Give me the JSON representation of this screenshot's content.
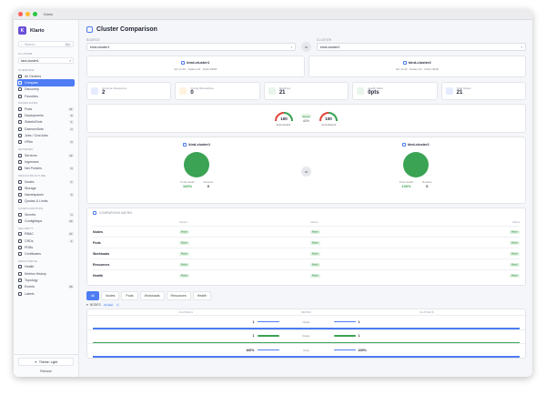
{
  "window": {
    "title": "Klario"
  },
  "brand": {
    "name": "Klario"
  },
  "search": {
    "placeholder": "Search...",
    "shortcut": "⌘K"
  },
  "sidebar": {
    "cluster_section": "CLUSTER",
    "cluster_value": "kind-cluster1",
    "sections": [
      {
        "label": "OVERVIEW",
        "items": [
          {
            "label": "All Clusters",
            "badge": ""
          },
          {
            "label": "Compare",
            "badge": "",
            "active": true
          },
          {
            "label": "Discovery",
            "badge": ""
          },
          {
            "label": "Favorites",
            "badge": ""
          }
        ]
      },
      {
        "label": "WORKLOADS",
        "items": [
          {
            "label": "Pods",
            "badge": "21"
          },
          {
            "label": "Deployments",
            "badge": "8"
          },
          {
            "label": "StatefulSets",
            "badge": "1"
          },
          {
            "label": "DaemonSets",
            "badge": "3"
          },
          {
            "label": "Jobs / CronJobs",
            "badge": ""
          },
          {
            "label": "HPAs",
            "badge": "0"
          }
        ]
      },
      {
        "label": "NETWORK",
        "items": [
          {
            "label": "Services",
            "badge": "12"
          },
          {
            "label": "Ingresses",
            "badge": ""
          },
          {
            "label": "Net Policies",
            "badge": "0"
          }
        ]
      },
      {
        "label": "INFRASTRUCTURE",
        "items": [
          {
            "label": "Nodes",
            "badge": "1"
          },
          {
            "label": "Storage",
            "badge": ""
          },
          {
            "label": "Namespaces",
            "badge": "6"
          },
          {
            "label": "Quotas & Limits",
            "badge": ""
          }
        ]
      },
      {
        "label": "CONFIGURATION",
        "items": [
          {
            "label": "Secrets",
            "badge": "4"
          },
          {
            "label": "ConfigMaps",
            "badge": "14"
          }
        ]
      },
      {
        "label": "SECURITY",
        "items": [
          {
            "label": "RBAC",
            "badge": "47"
          },
          {
            "label": "CRDs",
            "badge": "1"
          },
          {
            "label": "PDBs",
            "badge": ""
          },
          {
            "label": "Certificates",
            "badge": ""
          }
        ]
      },
      {
        "label": "MONITORING",
        "items": [
          {
            "label": "Health",
            "badge": ""
          },
          {
            "label": "Metrics History",
            "badge": ""
          },
          {
            "label": "Topology",
            "badge": ""
          },
          {
            "label": "Events",
            "badge": "45"
          },
          {
            "label": "Labels",
            "badge": ""
          }
        ]
      }
    ],
    "theme_label": "Theme: Light",
    "release_label": "Release"
  },
  "page": {
    "title": "Cluster Comparison",
    "source_label": "SOURCE",
    "target_label": "CLUSTER",
    "source_value": "kind-cluster1",
    "target_value": "kind-cluster2",
    "vs": "vs"
  },
  "clusters": [
    {
      "name": "kind-cluster1",
      "meta": "Ver v1.33 · Nodes 1/1 · Pods 18/18"
    },
    {
      "name": "kind-cluster2",
      "meta": "Ver v1.32 · Nodes 1/1 · Pods 18/18"
    }
  ],
  "stats": [
    {
      "label": "Common Resources",
      "value": "2",
      "color": "#e6ecff"
    },
    {
      "label": "Config Mismatches",
      "value": "0",
      "color": "#fff3e0"
    },
    {
      "label": "Matching",
      "value": "21",
      "color": "#e8f5ea"
    },
    {
      "label": "Health Delta",
      "value": "0pts",
      "color": "#e8f5ea"
    },
    {
      "label": "Total Nodes",
      "value": "21",
      "color": "#e6ecff"
    }
  ],
  "health": {
    "left_score": "100",
    "left_label": "kind-cluster1",
    "right_score": "100",
    "right_label": "kind-cluster2",
    "equal_label": "Equal",
    "equal_sub": "Δ0%"
  },
  "pods": [
    {
      "name": "kind-cluster1",
      "running_label": "Pods Health",
      "running": "100%",
      "restarts_label": "Restarts",
      "restarts": "0"
    },
    {
      "name": "kind-cluster2",
      "running_label": "Pods Health",
      "running": "100%",
      "restarts_label": "Restarts",
      "restarts": "0"
    }
  ],
  "matrix": {
    "title": "COMPARISON MATRIX",
    "columns": [
      "",
      "Cluster",
      "Cluster",
      "Status"
    ],
    "rows": [
      {
        "label": "Nodes",
        "a": "Match",
        "b": "Match",
        "c": "Match"
      },
      {
        "label": "Pods",
        "a": "Match",
        "b": "Match",
        "c": "Match"
      },
      {
        "label": "Workloads",
        "a": "Match",
        "b": "Match",
        "c": "Match"
      },
      {
        "label": "Resources",
        "a": "Match",
        "b": "Match",
        "c": "Match"
      },
      {
        "label": "Health",
        "a": "Match",
        "b": "Match",
        "c": "Match"
      }
    ]
  },
  "tabs": [
    "All",
    "Nodes",
    "Pods",
    "Workloads",
    "Resources",
    "Health"
  ],
  "nodes_section": {
    "label": "NODES",
    "count": "21 total",
    "count2": "1"
  },
  "node_table": {
    "columns": [
      "CLUSTER A",
      "METRIC",
      "CLUSTER B"
    ],
    "rows": [
      {
        "a": "1",
        "metric": "Nodes",
        "b": "1"
      },
      {
        "a": "1",
        "metric": "Ready",
        "b": "1"
      },
      {
        "a": "100%",
        "metric": "Pods",
        "b": "100%"
      }
    ]
  }
}
